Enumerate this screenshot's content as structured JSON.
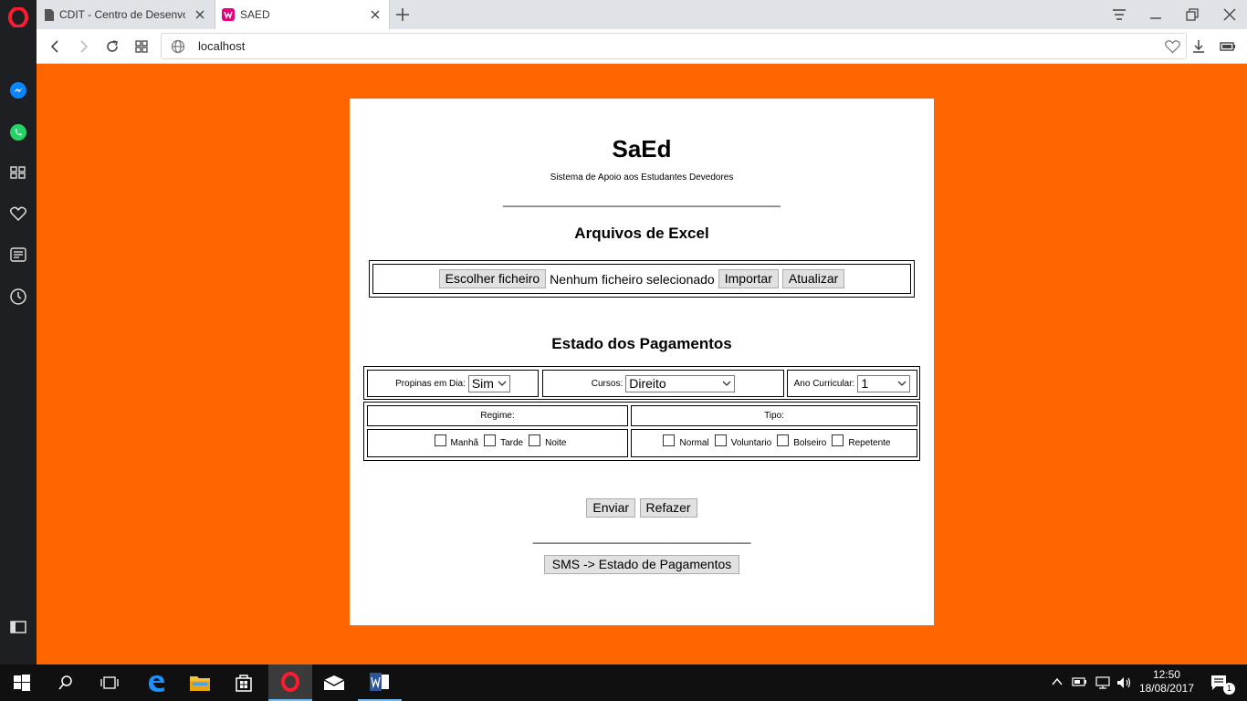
{
  "browser": {
    "tabs": [
      {
        "title": "CDIT - Centro de Desenvolvimento"
      },
      {
        "title": "SAED"
      }
    ],
    "url": "localhost"
  },
  "page": {
    "title": "SaEd",
    "subtitle": "Sistema de Apoio aos Estudantes Devedores",
    "separator1": "__________________________________________",
    "excel_heading": "Arquivos de Excel",
    "file_button": "Escolher ficheiro",
    "file_status": "Nenhum ficheiro selecionado",
    "import_button": "Importar",
    "update_button": "Atualizar",
    "payments_heading": "Estado dos Pagamentos",
    "propinas_label": "Propinas em Dia:",
    "propinas_value": "Sim",
    "cursos_label": "Cursos:",
    "cursos_value": "Direito",
    "ano_label": "Ano Curricular:",
    "ano_value": "1",
    "regime_label": "Regime:",
    "tipo_label": "Tipo:",
    "regime_options": [
      "Manhã",
      "Tarde",
      "Noite"
    ],
    "tipo_options": [
      "Normal",
      "Voluntario",
      "Bolseiro",
      "Repetente"
    ],
    "submit_button": "Enviar",
    "reset_button": "Refazer",
    "separator2": "_________________________________",
    "sms_button": "SMS -> Estado de Pagamentos"
  },
  "taskbar": {
    "time": "12:50",
    "date": "18/08/2017",
    "notifications": "1"
  }
}
